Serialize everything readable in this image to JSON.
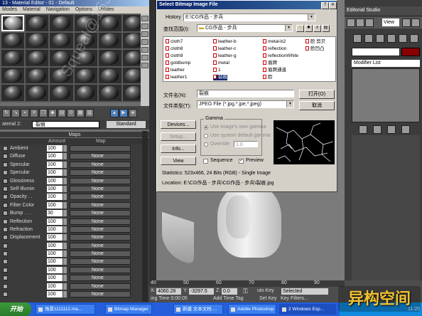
{
  "material_editor": {
    "title": "13 - Material Editor - 01 - Default",
    "menu": [
      "Modes",
      "Material",
      "Navigation",
      "Options",
      "Utilities"
    ],
    "material_label": "aterial 2:",
    "material_name": "裂痕",
    "material_type": "Standard",
    "maps_header": "Maps",
    "col_amount": "Amount",
    "col_map": "Map",
    "maps": [
      {
        "name": "Ambient",
        "amount": "100",
        "map": ""
      },
      {
        "name": "Diffuse",
        "amount": "100",
        "map": "None"
      },
      {
        "name": "Specular",
        "amount": "100",
        "map": "None"
      },
      {
        "name": "Specular",
        "amount": "100",
        "map": "None"
      },
      {
        "name": "Glossiness",
        "amount": "100",
        "map": "None"
      },
      {
        "name": "Self-Illumin",
        "amount": "100",
        "map": "None"
      },
      {
        "name": "Opacity . .",
        "amount": "100",
        "map": "None"
      },
      {
        "name": "Filter Color",
        "amount": "100",
        "map": "None"
      },
      {
        "name": "Bump . . .",
        "amount": "30",
        "map": "None"
      },
      {
        "name": "Reflection",
        "amount": "100",
        "map": "None"
      },
      {
        "name": "Refraction",
        "amount": "100",
        "map": "None"
      },
      {
        "name": "Displacement",
        "amount": "100",
        "map": "None"
      },
      {
        "name": "",
        "amount": "100",
        "map": "None"
      },
      {
        "name": "",
        "amount": "100",
        "map": "None"
      },
      {
        "name": "",
        "amount": "100",
        "map": "None"
      },
      {
        "name": "",
        "amount": "100",
        "map": "None"
      },
      {
        "name": "",
        "amount": "100",
        "map": "None"
      },
      {
        "name": "",
        "amount": "100",
        "map": "None"
      },
      {
        "name": "",
        "amount": "100",
        "map": "None"
      }
    ]
  },
  "dialog": {
    "title": "Select Bitmap Image File",
    "history_label": "History",
    "history_value": "E:\\CG作品 - 步兵",
    "lookin_label": "查找范围(I):",
    "lookin_value": "CG作品 - 步兵",
    "files": [
      [
        "cloth7",
        "leather-b",
        "metal-b2",
        "脸 剪贝"
      ],
      [
        "cloth8",
        "leather-c",
        "reflection",
        "脸凹凸"
      ],
      [
        "cloth9",
        "leather-g",
        "reflectionWhite",
        ""
      ],
      [
        "goldbump",
        "metal",
        "眉牌",
        ""
      ],
      [
        "leather",
        "1",
        "眉牌通道",
        ""
      ],
      [
        "leather1",
        "裂痕",
        "脸",
        ""
      ]
    ],
    "selected_file": "裂痕",
    "filename_label": "文件名(N):",
    "filename_value": "裂痕",
    "filetype_label": "文件类型(T):",
    "filetype_value": "JPEG File (*.jpg,*.jpe,*.jpeg)",
    "open_button": "打开(O)",
    "cancel_button": "取消",
    "gamma_label": "Gamma",
    "gamma_options": [
      "Use image's own gamma",
      "Use system default gamma",
      "Override"
    ],
    "override_value": "1.0",
    "devices_button": "Devices...",
    "setup_button": "Setup...",
    "info_button": "Info...",
    "view_button": "View",
    "sequence_label": "Sequence",
    "preview_label": "Preview",
    "statistics": "Statistics:  523x466, 24 Bits (RGB) - Single Image",
    "location": "Location:  E:\\CG作品 - 步兵\\CG作品 - 步兵\\裂痕.jpg"
  },
  "right_panel": {
    "title": "Editorial Studio",
    "view_value": "View",
    "modifier_list": "Modifier List",
    "object_color": "#8a0000"
  },
  "timeline": {
    "ruler": [
      "40",
      "50",
      "60",
      "70",
      "80",
      "90"
    ],
    "x_label": "X:",
    "x_value": "4060.28",
    "y_label": "Y:",
    "y_value": "-3297.5",
    "z_label": "Z:",
    "z_value": "0.0",
    "key_mode": "uto Key",
    "selected_value": "Selected",
    "time_label": "ing Time  0:00:05",
    "add_time_tag": "Add Time Tag",
    "set_key": "Set Key",
    "key_filters": "Key Filters..."
  },
  "taskbar": {
    "start": "开始",
    "tasks": [
      "场景1111112.ma...",
      "Bitmap Manager",
      "新建 文本文档 ...",
      "Adobe Photoshop",
      "2 Windows Exp..."
    ],
    "clock": "11:20"
  },
  "watermarks": {
    "logo": "异构空间",
    "diagonal": "Squeal@163.com  QQ:14515643"
  }
}
